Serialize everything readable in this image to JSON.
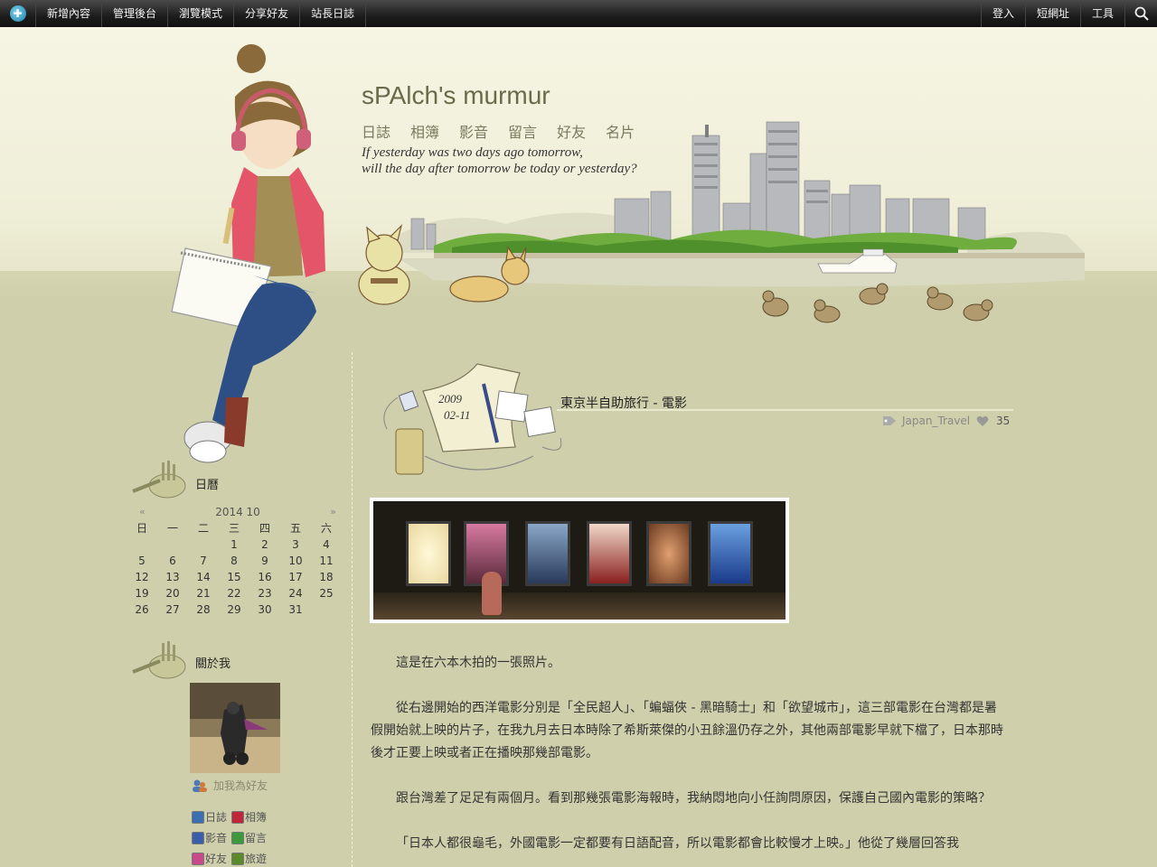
{
  "topbar": {
    "left_items": [
      "新增內容",
      "管理後台",
      "瀏覽模式",
      "分享好友",
      "站長日誌"
    ],
    "right_items": [
      "登入",
      "短網址",
      "工具"
    ]
  },
  "blog": {
    "title": "sPAlch's murmur",
    "nav": [
      "日誌",
      "相簿",
      "影音",
      "留言",
      "好友",
      "名片"
    ],
    "tagline_line1": "If yesterday was two days ago tomorrow,",
    "tagline_line2": "will the day after tomorrow be today or yesterday?"
  },
  "calendar_widget": {
    "title": "日曆",
    "month": "2014 10",
    "prev": "«",
    "next": "»",
    "weekdays": [
      "日",
      "一",
      "二",
      "三",
      "四",
      "五",
      "六"
    ],
    "weeks": [
      [
        "",
        "",
        "",
        "1",
        "2",
        "3",
        "4"
      ],
      [
        "5",
        "6",
        "7",
        "8",
        "9",
        "10",
        "11"
      ],
      [
        "12",
        "13",
        "14",
        "15",
        "16",
        "17",
        "18"
      ],
      [
        "19",
        "20",
        "21",
        "22",
        "23",
        "24",
        "25"
      ],
      [
        "26",
        "27",
        "28",
        "29",
        "30",
        "31",
        ""
      ]
    ]
  },
  "about_widget": {
    "title": "關於我",
    "add_friend": "加我為好友",
    "links": [
      {
        "label": "日誌",
        "icon": "journal-icon",
        "color": "#3a6fb0"
      },
      {
        "label": "相簿",
        "icon": "album-icon",
        "color": "#c0263a"
      },
      {
        "label": "影音",
        "icon": "video-icon",
        "color": "#3a5fa8"
      },
      {
        "label": "留言",
        "icon": "guestbook-icon",
        "color": "#3c9a3c"
      },
      {
        "label": "好友",
        "icon": "friends-icon",
        "color": "#c84a8a"
      },
      {
        "label": "旅遊",
        "icon": "travel-icon",
        "color": "#5a8a2a"
      }
    ]
  },
  "post": {
    "year": "2009",
    "monthday": "02-11",
    "title": "東京半自助旅行 - 電影",
    "category": "Japan_Travel",
    "likes": "35",
    "paragraphs": [
      "這是在六本木拍的一張照片。",
      "從右邊開始的西洋電影分別是「全民超人」、「蝙蝠俠 - 黑暗騎士」和「欲望城市」，這三部電影在台灣都是暑假開始就上映的片子，在我九月去日本時除了希斯萊傑的小丑餘溫仍存之外，其他兩部電影早就下檔了，日本那時後才正要上映或者正在播映那幾部電影。",
      "跟台灣差了足足有兩個月。看到那幾張電影海報時，我納悶地向小任詢問原因，保護自己國內電影的策略？",
      "「日本人都很龜毛，外國電影一定都要有日語配音，所以電影都會比較慢才上映。」他從了幾層回答我"
    ]
  },
  "colors": {
    "topbar": "#1c1c1c",
    "header_bg": "#f6f5e4",
    "page_bg": "#cfcfac",
    "title": "#6a6a4a"
  }
}
